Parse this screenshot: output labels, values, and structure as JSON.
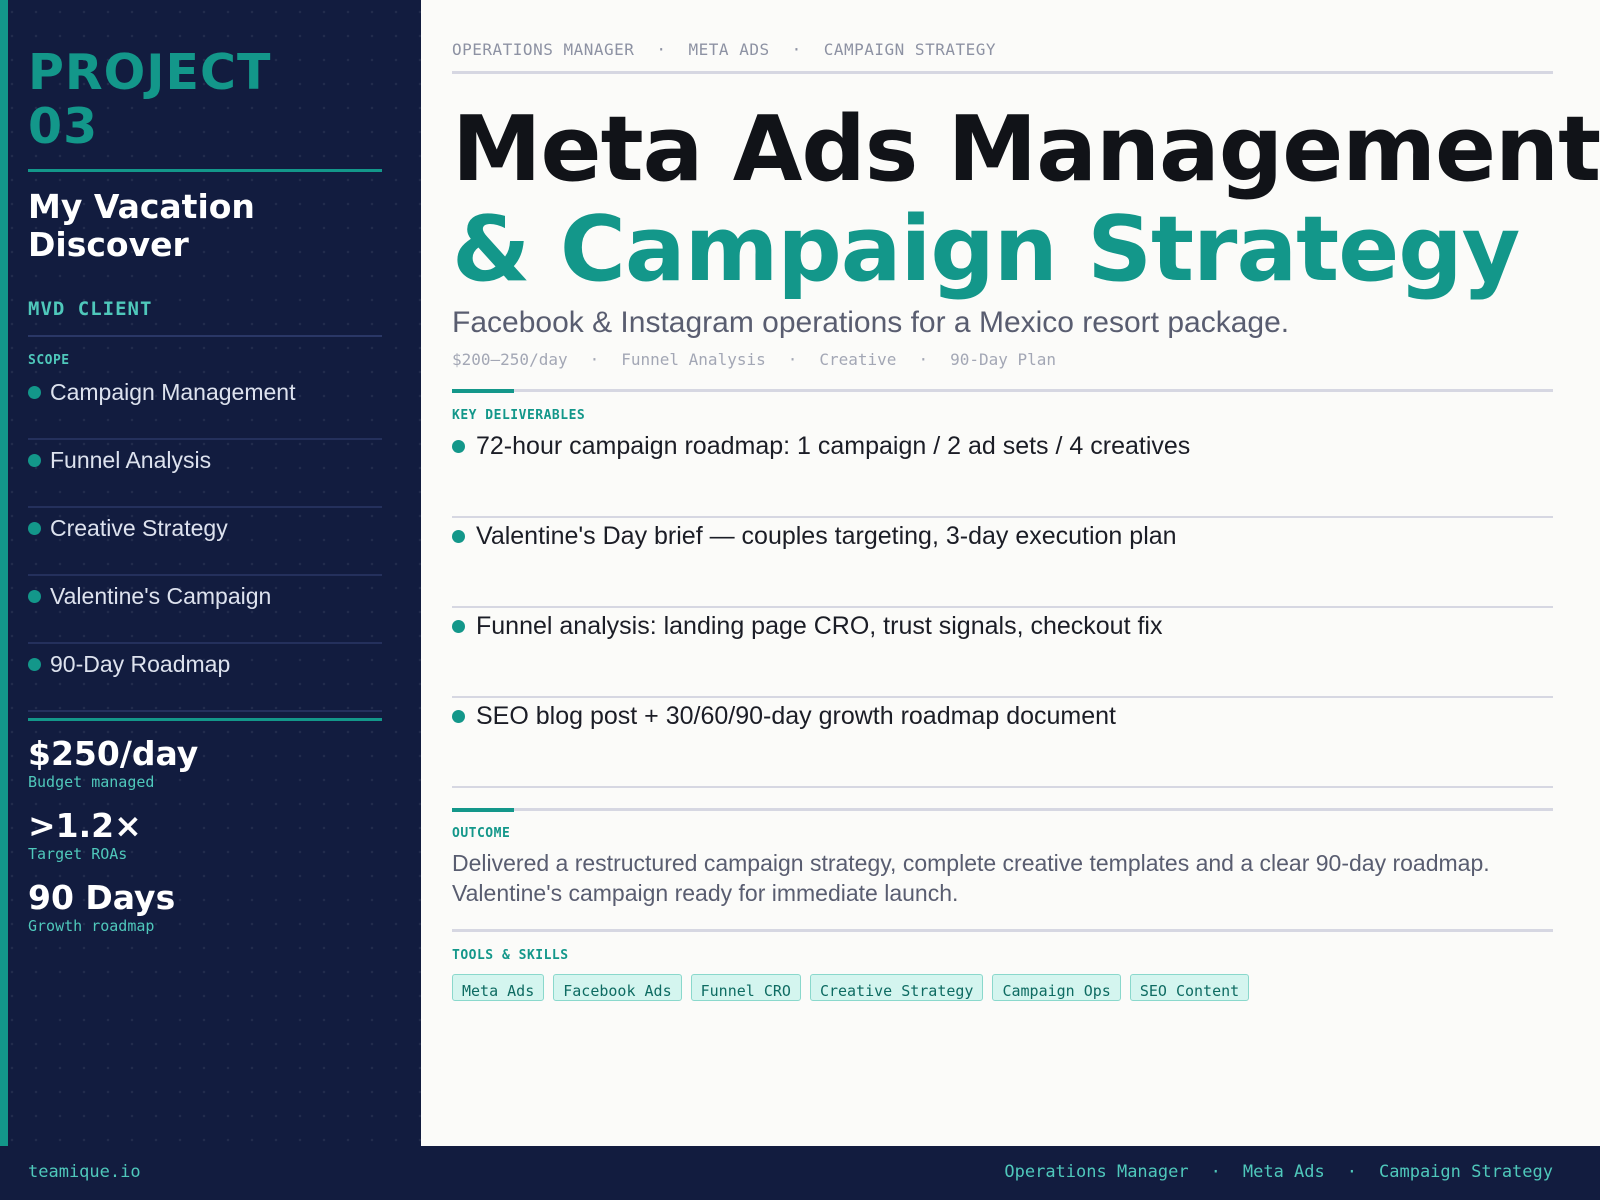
{
  "sidebar": {
    "project_label": [
      "PROJECT",
      "03"
    ],
    "client_name": [
      "My Vacation",
      "Discover"
    ],
    "client_tag": "MVD CLIENT",
    "scope_label": "SCOPE",
    "scope_items": [
      "Campaign Management",
      "Funnel Analysis",
      "Creative Strategy",
      "Valentine's Campaign",
      "90-Day Roadmap"
    ],
    "stats": [
      {
        "value": "$250/day",
        "caption": "Budget managed"
      },
      {
        "value": ">1.2×",
        "caption": "Target ROAs"
      },
      {
        "value": "90 Days",
        "caption": "Growth roadmap"
      }
    ]
  },
  "main": {
    "breadcrumb": [
      "OPERATIONS MANAGER",
      "META ADS",
      "CAMPAIGN STRATEGY"
    ],
    "breadcrumb_separator": "·",
    "title_line1": "Meta Ads Management",
    "title_line2": "& Campaign Strategy",
    "subtitle": "Facebook & Instagram operations for a Mexico resort package.",
    "meta": [
      "$200–250/day",
      "Funnel Analysis",
      "Creative",
      "90-Day Plan"
    ],
    "deliverables_label": "KEY DELIVERABLES",
    "deliverables": [
      "72-hour campaign roadmap: 1 campaign / 2 ad sets / 4 creatives",
      "Valentine's Day brief — couples targeting, 3-day execution plan",
      "Funnel analysis: landing page CRO, trust signals, checkout fix",
      "SEO blog post + 30/60/90-day growth roadmap document"
    ],
    "outcome_label": "OUTCOME",
    "outcome_lines": [
      "Delivered a restructured campaign strategy, complete creative templates and a clear 90-day roadmap.",
      "Valentine's campaign ready for immediate launch."
    ],
    "tools_label": "TOOLS & SKILLS",
    "tools": [
      "Meta Ads",
      "Facebook Ads",
      "Funnel CRO",
      "Creative Strategy",
      "Campaign Ops",
      "SEO Content"
    ]
  },
  "footer": {
    "site": "teamique.io",
    "crumbs": [
      "Operations Manager",
      "Meta Ads",
      "Campaign Strategy"
    ]
  },
  "colors": {
    "navy": "#121c3f",
    "teal": "#13978a",
    "teal_light": "#4fc8bb",
    "ink": "#111318",
    "muted": "#595d70"
  }
}
